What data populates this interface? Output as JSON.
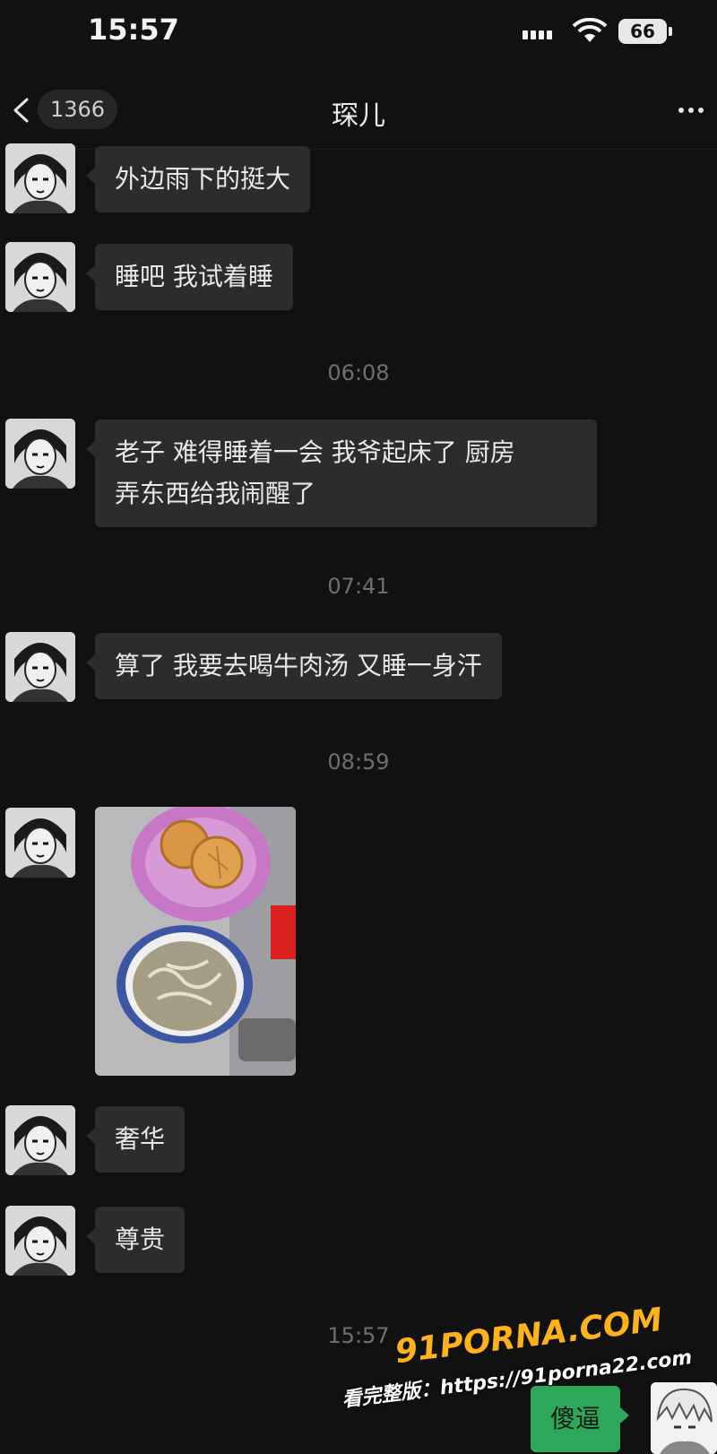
{
  "status_bar": {
    "time": "15:57",
    "battery": "66"
  },
  "nav": {
    "back_count": "1366",
    "title": "琛儿"
  },
  "messages": [
    {
      "text": "外边雨下的挺大"
    },
    {
      "text": "睡吧 我试着睡"
    },
    {
      "time": "06:08"
    },
    {
      "text_line1": "老子 难得睡着一会 我爷起床了 厨房",
      "text_line2": "弄东西给我闹醒了"
    },
    {
      "time": "07:41"
    },
    {
      "text": "算了 我要去喝牛肉汤 又睡一身汗"
    },
    {
      "time": "08:59"
    },
    {
      "photo": "food-photo"
    },
    {
      "text": "奢华"
    },
    {
      "text": "尊贵"
    },
    {
      "time": "15:57"
    },
    {
      "text": "傻逼"
    }
  ],
  "watermark": {
    "logo": "91PORNA.COM",
    "url": "看完整版：https://91porna22.com"
  },
  "colors": {
    "background": "#111111",
    "bubble_peer": "#2c2c2c",
    "bubble_self": "#2ea75a",
    "timestamp": "#6f6f6f"
  }
}
